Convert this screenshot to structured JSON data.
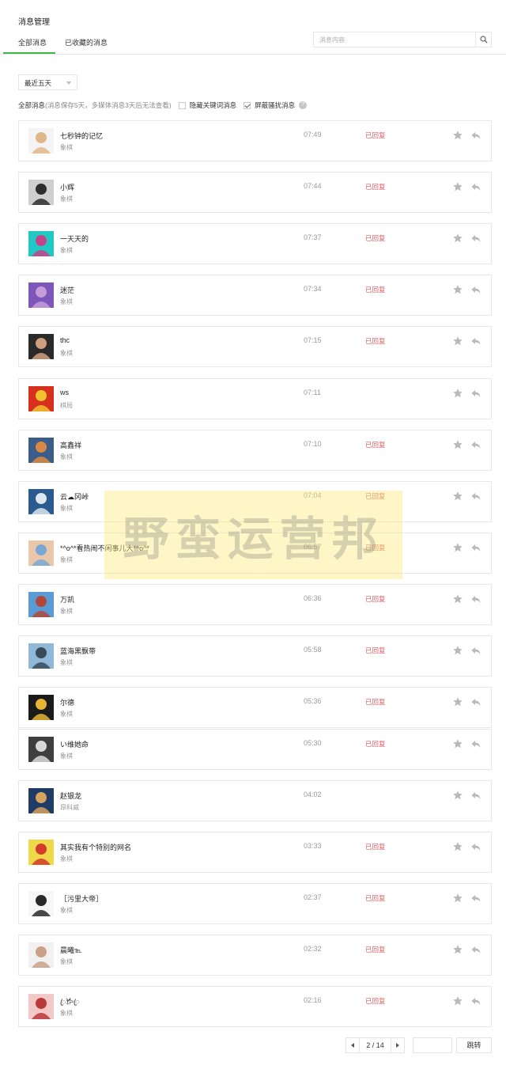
{
  "header": {
    "title": "消息管理"
  },
  "tabs": [
    {
      "label": "全部消息",
      "active": true
    },
    {
      "label": "已收藏的消息",
      "active": false
    }
  ],
  "search": {
    "placeholder": "消息内容"
  },
  "range_select": {
    "value": "最近五天"
  },
  "filter": {
    "title": "全部消息",
    "note": "(消息保存5天，多媒体消息3天后无法查看)",
    "hide_keyword": {
      "label": "隐藏关键词消息",
      "checked": false
    },
    "block_spam": {
      "label": "屏蔽骚扰消息",
      "checked": true
    }
  },
  "accent_color": "#44b549",
  "status_color": "#e15f63",
  "messages": [
    {
      "name": "七秒钟的记忆",
      "sub": "象棋",
      "time": "07:49",
      "status": "已回复",
      "avatar_colors": [
        "#f4f4f4",
        "#e0b78a"
      ]
    },
    {
      "name": "小辉",
      "sub": "象棋",
      "time": "07:44",
      "status": "已回复",
      "avatar_colors": [
        "#cfcfcf",
        "#2d2d2d"
      ]
    },
    {
      "name": "一天天的",
      "sub": "象棋",
      "time": "07:37",
      "status": "已回复",
      "avatar_colors": [
        "#21c9c2",
        "#c4428a"
      ]
    },
    {
      "name": "迷茫",
      "sub": "象棋",
      "time": "07:34",
      "status": "已回复",
      "avatar_colors": [
        "#7c56b8",
        "#c79ad8"
      ]
    },
    {
      "name": "thc",
      "sub": "象棋",
      "time": "07:15",
      "status": "已回复",
      "avatar_colors": [
        "#2b2a2a",
        "#d0a07e"
      ]
    },
    {
      "name": "ws",
      "sub": "棋局",
      "time": "07:11",
      "status": "",
      "avatar_colors": [
        "#d8301f",
        "#f2c12e"
      ]
    },
    {
      "name": "高鑫祥",
      "sub": "象棋",
      "time": "07:10",
      "status": "已回复",
      "avatar_colors": [
        "#3c5d8a",
        "#d98a42"
      ]
    },
    {
      "name": "云☁冈峠",
      "sub": "象棋",
      "time": "07:04",
      "status": "已回复",
      "avatar_colors": [
        "#2b5a8f",
        "#dde6ef"
      ]
    },
    {
      "name": "*^o^*看热闹不闲事儿大*^o^*",
      "sub": "象棋",
      "time": "06:57",
      "status": "已回复",
      "avatar_colors": [
        "#e9c7a8",
        "#7aa8d6"
      ]
    },
    {
      "name": "万凯",
      "sub": "象棋",
      "time": "06:36",
      "status": "已回复",
      "avatar_colors": [
        "#5b9bd5",
        "#b0483a"
      ]
    },
    {
      "name": "蓝海黑飘带",
      "sub": "象棋",
      "time": "05:58",
      "status": "已回复",
      "avatar_colors": [
        "#8fb8d9",
        "#3a4a5a"
      ]
    },
    {
      "name": "尔德",
      "sub": "象棋",
      "time": "05:36",
      "status": "已回复",
      "avatar_colors": [
        "#1a1a1a",
        "#e8b431"
      ]
    },
    {
      "name": "い维她命",
      "sub": "象棋",
      "time": "05:30",
      "status": "已回复",
      "avatar_colors": [
        "#3f3f3f",
        "#d9d9d9"
      ]
    },
    {
      "name": "赵银龙",
      "sub": "昂科威",
      "time": "04:02",
      "status": "",
      "avatar_colors": [
        "#1f3b66",
        "#d8a35e"
      ]
    },
    {
      "name": "其实我有个特别的网名",
      "sub": "象棋",
      "time": "03:33",
      "status": "已回复",
      "avatar_colors": [
        "#f0d84b",
        "#d33b2c"
      ]
    },
    {
      "name": "［污里大帝］",
      "sub": "象棋",
      "time": "02:37",
      "status": "已回复",
      "avatar_colors": [
        "#f7f7f7",
        "#2a2a2a"
      ]
    },
    {
      "name": "晨曦℡",
      "sub": "象棋",
      "time": "02:32",
      "status": "已回复",
      "avatar_colors": [
        "#f1f1f1",
        "#caa187"
      ]
    },
    {
      "name": "ꦿ𐂂ꦿ",
      "sub": "象棋",
      "time": "02:16",
      "status": "已回复",
      "avatar_colors": [
        "#f2c8c8",
        "#b93a3a"
      ]
    }
  ],
  "icons": {
    "star": "star-icon",
    "reply": "reply-icon",
    "search": "search-icon",
    "help": "help-icon"
  },
  "watermark": {
    "text": "野蛮运营邦"
  },
  "pagination": {
    "label": "2 / 14",
    "jump_label": "跳转",
    "jump_value": ""
  }
}
